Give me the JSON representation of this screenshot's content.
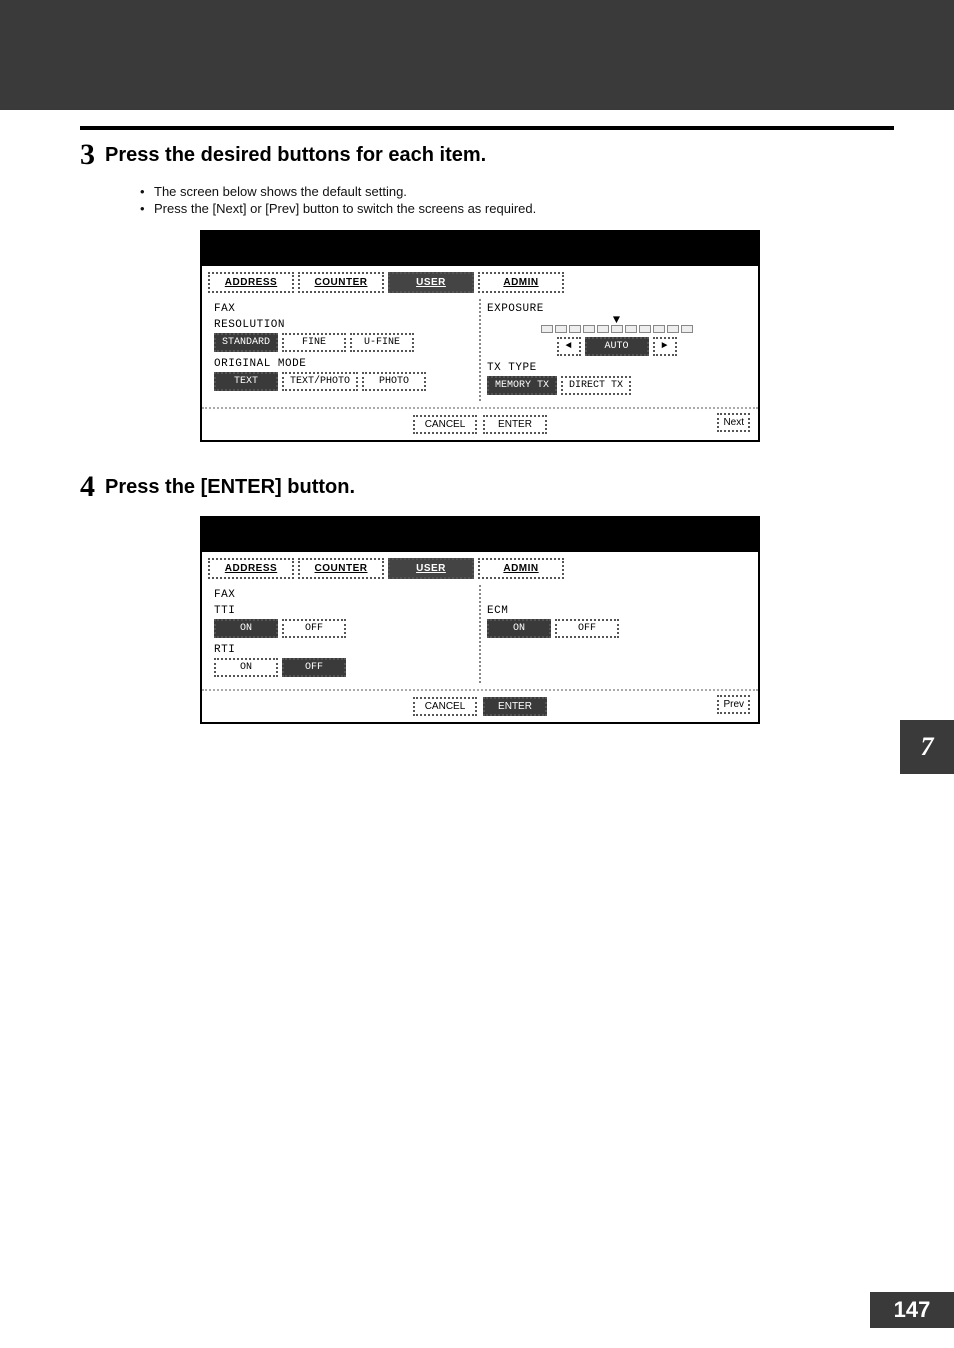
{
  "page": {
    "section_number": "7",
    "page_number": "147"
  },
  "steps": {
    "s3": {
      "num": "3",
      "title": "Press the desired buttons for each item.",
      "bullets": [
        "The screen below shows the default setting.",
        "Press the [Next] or [Prev] button to switch the screens as required."
      ]
    },
    "s4": {
      "num": "4",
      "title": "Press the [ENTER] button."
    }
  },
  "tabs": {
    "address": "ADDRESS",
    "counter": "COUNTER",
    "user": "USER",
    "admin": "ADMIN"
  },
  "panel1": {
    "heading": "FAX",
    "resolution": {
      "label": "RESOLUTION",
      "standard": "STANDARD",
      "fine": "FINE",
      "ufine": "U-FINE"
    },
    "original_mode": {
      "label": "ORIGINAL MODE",
      "text": "TEXT",
      "text_photo": "TEXT/PHOTO",
      "photo": "PHOTO"
    },
    "exposure": {
      "label": "EXPOSURE",
      "left": "◄",
      "auto": "AUTO",
      "right": "►"
    },
    "tx_type": {
      "label": "TX TYPE",
      "memory": "MEMORY TX",
      "direct": "DIRECT TX"
    },
    "footer": {
      "cancel": "CANCEL",
      "enter": "ENTER",
      "nav": "Next"
    }
  },
  "panel2": {
    "heading": "FAX",
    "tti": {
      "label": "TTI",
      "on": "ON",
      "off": "OFF"
    },
    "rti": {
      "label": "RTI",
      "on": "ON",
      "off": "OFF"
    },
    "ecm": {
      "label": "ECM",
      "on": "ON",
      "off": "OFF"
    },
    "footer": {
      "cancel": "CANCEL",
      "enter": "ENTER",
      "nav": "Prev"
    }
  }
}
